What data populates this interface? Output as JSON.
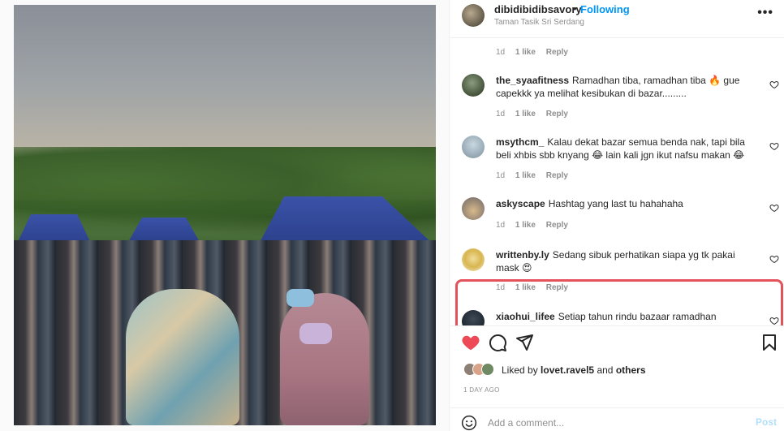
{
  "post": {
    "image_icon": "photo-image",
    "author": {
      "username": "dibidibidibsavory",
      "separator": "•",
      "follow_label": "Following",
      "location": "Taman Tasik Sri Serdang"
    },
    "more_icon": "more-horizontal-icon",
    "more_label": "•••"
  },
  "comments": [
    {
      "username": "",
      "text": "",
      "time": "1d",
      "likes": "1 like",
      "reply": "Reply"
    },
    {
      "username": "the_syaafitness",
      "text": "Ramadhan tiba, ramadhan tiba 🔥 gue capekkk ya melihat kesibukan di bazar.........",
      "time": "1d",
      "likes": "1 like",
      "reply": "Reply"
    },
    {
      "username": "msythcm_",
      "text": "Kalau dekat bazar semua benda nak, tapi bila beli xhbis sbb knyang 😂 lain kali jgn ikut nafsu makan 😂",
      "time": "1d",
      "likes": "1 like",
      "reply": "Reply"
    },
    {
      "username": "askyscape",
      "text": "Hashtag yang last tu hahahaha",
      "time": "1d",
      "likes": "1 like",
      "reply": "Reply"
    },
    {
      "username": "writtenby.ly",
      "text": "Sedang sibuk perhatikan siapa yg tk pakai mask 😍",
      "time": "1d",
      "likes": "1 like",
      "reply": "Reply"
    },
    {
      "username": "xiaohui_lifee",
      "text": "Setiap tahun rindu bazaar ramadhan walaupun",
      "time": "",
      "likes": "",
      "reply": ""
    }
  ],
  "actions": {
    "like_icon": "heart-filled-icon",
    "comment_icon": "comment-icon",
    "share_icon": "send-icon",
    "save_icon": "bookmark-icon",
    "like_color": "#ed4956"
  },
  "likes_summary": {
    "prefix": "Liked by",
    "user": "lovet.ravel5",
    "joiner": "and",
    "others": "others"
  },
  "timestamp": "1 DAY AGO",
  "add_comment": {
    "emoji_icon": "smiley-icon",
    "placeholder": "Add a comment...",
    "post_label": "Post"
  },
  "colors": {
    "accent": "#0095f6",
    "highlight_border": "#e5525b",
    "muted_text": "#8e8e8e"
  }
}
